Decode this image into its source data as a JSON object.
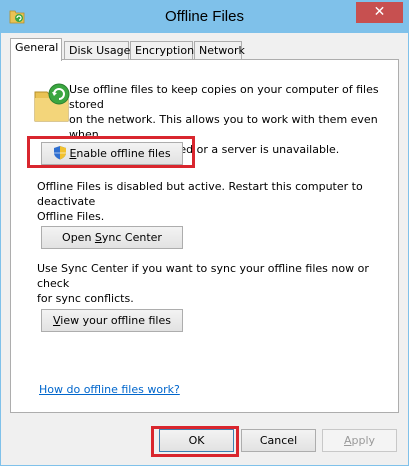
{
  "window": {
    "title": "Offline Files",
    "close_glyph": "✕"
  },
  "tabs": [
    {
      "label": "General",
      "active": true
    },
    {
      "label": "Disk Usage",
      "active": false
    },
    {
      "label": "Encryption",
      "active": false
    },
    {
      "label": "Network",
      "active": false
    }
  ],
  "general": {
    "intro_line1": "Use offline files to keep copies on your computer of files stored",
    "intro_line2": "on the network.  This allows you to work with them even when",
    "intro_line3": "you are not connected or a server is unavailable.",
    "enable_button": {
      "access_key": "E",
      "rest": "nable offline files"
    },
    "status_line1": "Offline Files is disabled but active.  Restart this computer to deactivate",
    "status_line2": "Offline Files.",
    "sync_button": {
      "before": "Open ",
      "access_key": "S",
      "after": "ync Center"
    },
    "sync_line1": "Use Sync Center if you want to sync your offline files now or check",
    "sync_line2": "for sync conflicts.",
    "view_button": {
      "access_key": "V",
      "rest": "iew your offline files"
    },
    "help_link": "How do offline files work?"
  },
  "footer": {
    "ok_label": "OK",
    "cancel_label": "Cancel",
    "apply_before": "",
    "apply_access_key": "A",
    "apply_after": "pply"
  },
  "colors": {
    "titlebar": "#7fc1ea",
    "close_button": "#c75050",
    "highlight": "#d9262e",
    "link": "#0066cc"
  },
  "icons": {
    "app": "offline-files-icon",
    "folder": "sync-folder-icon",
    "shield": "uac-shield-icon"
  }
}
